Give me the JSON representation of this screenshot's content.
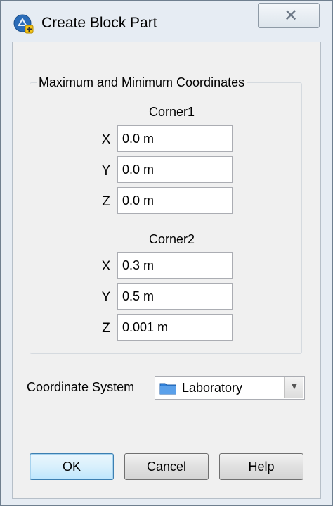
{
  "window": {
    "title": "Create Block Part",
    "close_label": "✕",
    "app_icon": "block-part-app-icon"
  },
  "group": {
    "title": "Maximum and Minimum Coordinates",
    "corner1": {
      "label": "Corner1",
      "fields": [
        {
          "axis": "X",
          "value": "0.0 m"
        },
        {
          "axis": "Y",
          "value": "0.0 m"
        },
        {
          "axis": "Z",
          "value": "0.0 m"
        }
      ]
    },
    "corner2": {
      "label": "Corner2",
      "fields": [
        {
          "axis": "X",
          "value": "0.3 m"
        },
        {
          "axis": "Y",
          "value": "0.5 m"
        },
        {
          "axis": "Z",
          "value": "0.001 m"
        }
      ]
    }
  },
  "coordinate_system": {
    "label": "Coordinate System",
    "selected": "Laboratory",
    "icon": "folder-icon"
  },
  "buttons": {
    "ok": "OK",
    "cancel": "Cancel",
    "help": "Help"
  },
  "colors": {
    "default_button_border": "#3c7fb1",
    "folder_blue": "#2f7fd8"
  }
}
